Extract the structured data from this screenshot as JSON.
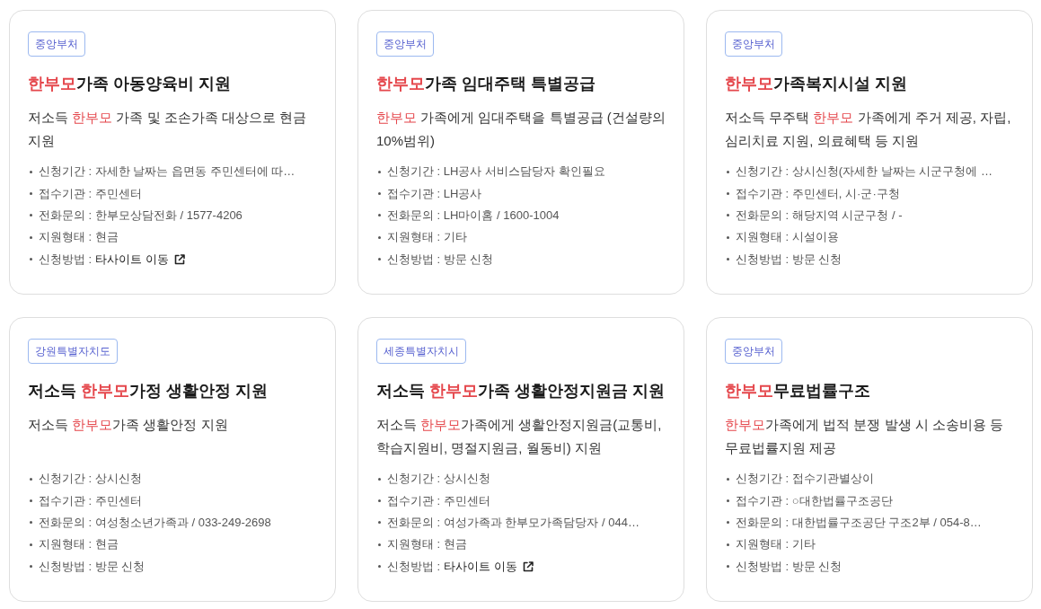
{
  "cards": [
    {
      "tag": "중앙부처",
      "title": [
        {
          "text": "한부모",
          "highlight": true
        },
        {
          "text": "가족 아동양육비 지원",
          "highlight": false
        }
      ],
      "description": [
        {
          "text": "저소득 ",
          "highlight": false
        },
        {
          "text": "한부모",
          "highlight": true
        },
        {
          "text": " 가족 및 조손가족 대상으로 현금 지원",
          "highlight": false
        }
      ],
      "details": [
        {
          "kind": "text",
          "text": "신청기간 : 자세한 날짜는 읍면동 주민센터에 따…"
        },
        {
          "kind": "text",
          "text": "접수기관 : 주민센터"
        },
        {
          "kind": "text",
          "text": "전화문의 : 한부모상담전화 / 1577-4206"
        },
        {
          "kind": "text",
          "text": "지원형태 : 현금"
        },
        {
          "kind": "link",
          "text": "신청방법 :",
          "link": "타사이트 이동"
        }
      ]
    },
    {
      "tag": "중앙부처",
      "title": [
        {
          "text": "한부모",
          "highlight": true
        },
        {
          "text": "가족 임대주택 특별공급",
          "highlight": false
        }
      ],
      "description": [
        {
          "text": "한부모",
          "highlight": true
        },
        {
          "text": " 가족에게 임대주택을 특별공급 (건설량의 10%범위)",
          "highlight": false
        }
      ],
      "details": [
        {
          "kind": "text",
          "text": "신청기간 : LH공사 서비스담당자 확인필요"
        },
        {
          "kind": "text",
          "text": "접수기관 : LH공사"
        },
        {
          "kind": "text",
          "text": "전화문의 : LH마이홈 / 1600-1004"
        },
        {
          "kind": "text",
          "text": "지원형태 : 기타"
        },
        {
          "kind": "text",
          "text": "신청방법 : 방문 신청"
        }
      ]
    },
    {
      "tag": "중앙부처",
      "title": [
        {
          "text": "한부모",
          "highlight": true
        },
        {
          "text": "가족복지시설 지원",
          "highlight": false
        }
      ],
      "description": [
        {
          "text": "저소득 무주택 ",
          "highlight": false
        },
        {
          "text": "한부모",
          "highlight": true
        },
        {
          "text": " 가족에게 주거 제공, 자립, 심리치료 지원, 의료혜택 등 지원",
          "highlight": false
        }
      ],
      "details": [
        {
          "kind": "text",
          "text": "신청기간 : 상시신청(자세한 날짜는 시군구청에 …"
        },
        {
          "kind": "text",
          "text": "접수기관 : 주민센터, 시·군·구청"
        },
        {
          "kind": "text",
          "text": "전화문의 : 해당지역 시군구청 / -"
        },
        {
          "kind": "text",
          "text": "지원형태 : 시설이용"
        },
        {
          "kind": "text",
          "text": "신청방법 : 방문 신청"
        }
      ]
    },
    {
      "tag": "강원특별자치도",
      "title": [
        {
          "text": "저소득 ",
          "highlight": false
        },
        {
          "text": "한부모",
          "highlight": true
        },
        {
          "text": "가정 생활안정 지원",
          "highlight": false
        }
      ],
      "description": [
        {
          "text": "저소득 ",
          "highlight": false
        },
        {
          "text": "한부모",
          "highlight": true
        },
        {
          "text": "가족 생활안정 지원",
          "highlight": false
        }
      ],
      "details": [
        {
          "kind": "text",
          "text": "신청기간 : 상시신청"
        },
        {
          "kind": "text",
          "text": "접수기관 : 주민센터"
        },
        {
          "kind": "text",
          "text": "전화문의 : 여성청소년가족과 / 033-249-2698"
        },
        {
          "kind": "text",
          "text": "지원형태 : 현금"
        },
        {
          "kind": "text",
          "text": "신청방법 : 방문 신청"
        }
      ]
    },
    {
      "tag": "세종특별자치시",
      "title": [
        {
          "text": "저소득 ",
          "highlight": false
        },
        {
          "text": "한부모",
          "highlight": true
        },
        {
          "text": "가족 생활안정지원금 지원",
          "highlight": false
        }
      ],
      "description": [
        {
          "text": "저소득 ",
          "highlight": false
        },
        {
          "text": "한부모",
          "highlight": true
        },
        {
          "text": "가족에게 생활안정지원금(교통비, 학습지원비, 명절지원금, 월동비) 지원",
          "highlight": false
        }
      ],
      "details": [
        {
          "kind": "text",
          "text": "신청기간 : 상시신청"
        },
        {
          "kind": "text",
          "text": "접수기관 : 주민센터"
        },
        {
          "kind": "text",
          "text": "전화문의 : 여성가족과 한부모가족담당자 / 044…"
        },
        {
          "kind": "text",
          "text": "지원형태 : 현금"
        },
        {
          "kind": "link",
          "text": "신청방법 :",
          "link": "타사이트 이동"
        }
      ]
    },
    {
      "tag": "중앙부처",
      "title": [
        {
          "text": "한부모",
          "highlight": true
        },
        {
          "text": "무료법률구조",
          "highlight": false
        }
      ],
      "description": [
        {
          "text": "한부모",
          "highlight": true
        },
        {
          "text": "가족에게 법적 분쟁 발생 시 소송비용 등 무료법률지원 제공",
          "highlight": false
        }
      ],
      "details": [
        {
          "kind": "text",
          "text": "신청기간 : 접수기관별상이"
        },
        {
          "kind": "text",
          "text": "접수기관 : ○대한법률구조공단"
        },
        {
          "kind": "text",
          "text": "전화문의 : 대한법률구조공단 구조2부 / 054-8…"
        },
        {
          "kind": "text",
          "text": "지원형태 : 기타"
        },
        {
          "kind": "text",
          "text": "신청방법 : 방문 신청"
        }
      ]
    }
  ]
}
